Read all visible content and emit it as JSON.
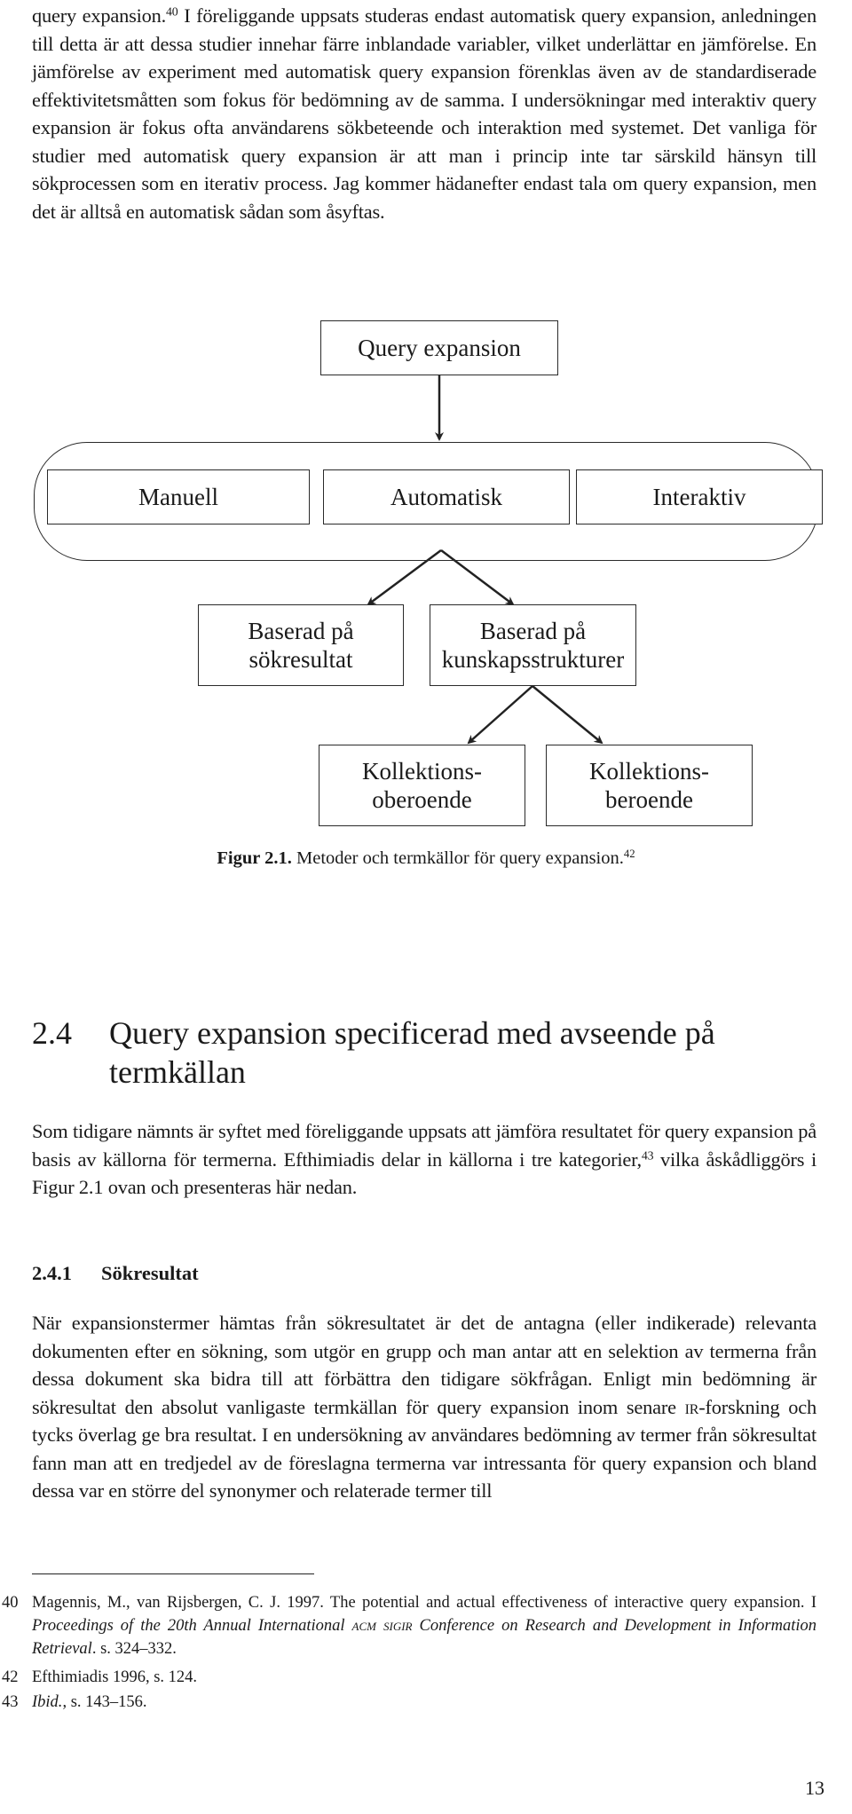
{
  "intro_paragraph": {
    "line_1a": "query expansion.",
    "sup_40": "40",
    "rest": " I föreliggande uppsats studeras endast automatisk query expansion, anledningen till detta är att dessa studier innehar färre inblandade variabler, vilket underlättar en jämförelse. En jämförelse av experiment med automatisk query expansion förenklas även av de standardiserade effektivitetsmåtten som fokus för bedömning av de samma. I undersökningar med interaktiv query expansion är fokus ofta användarens sökbeteende och interaktion med systemet. Det vanliga för studier med automatisk query expansion är att man i princip inte tar särskild hänsyn till sökprocessen som en iterativ process. Jag kommer hädanefter endast tala om query expansion, men det är alltså en automatisk sådan som åsyftas."
  },
  "figure": {
    "root": "Query expansion",
    "methods": [
      "Manuell",
      "Automatisk",
      "Interaktiv"
    ],
    "sources": [
      {
        "line1": "Baserad på",
        "line2": "sökresultat"
      },
      {
        "line1": "Baserad på",
        "line2": "kunskapsstrukturer"
      }
    ],
    "structures": [
      {
        "line1": "Kollektions-",
        "line2": "oberoende"
      },
      {
        "line1": "Kollektions-",
        "line2": "beroende"
      }
    ],
    "caption_label": "Figur 2.1.",
    "caption_text": " Metoder och termkällor för query expansion.",
    "caption_sup": "42"
  },
  "section": {
    "number": "2.4",
    "title": "Query expansion specificerad med avseende på termkällan",
    "paragraph_a": "Som tidigare nämnts är syftet med föreliggande uppsats att jämföra resultatet för query expansion på basis av källorna för termerna. Efthimiadis delar in källorna i tre kategorier,",
    "sup_43": "43",
    "paragraph_b": " vilka åskådliggörs i Figur 2.1 ovan och presenteras här nedan."
  },
  "subsection": {
    "number": "2.4.1",
    "title": "Sökresultat",
    "para_a": "När expansionstermer hämtas från sökresultatet är det de antagna (eller indikerade) relevanta dokumenten efter en sökning, som utgör en grupp och man antar att en selektion av termerna från dessa dokument ska bidra till att förbättra den tidigare sökfrågan. Enligt min bedömning är sökresultat den absolut vanligaste termkällan för query expansion inom senare ",
    "ir": "IR",
    "para_b": "-forskning och tycks överlag ge bra resultat. I en undersökning av användares bedömning av termer från sökresultat fann man att en tredjedel av de föreslagna termerna var intressanta för query expansion och bland dessa var en större del synonymer och relaterade termer till"
  },
  "footnotes": [
    {
      "number": "40",
      "pre": "Magennis, M., van Rijsbergen, C. J. 1997. The potential and actual effectiveness of interactive query expansion. I ",
      "italic_a": "Proceedings of the 20th Annual International ",
      "sc": "ACM SIGIR",
      "italic_b": " Conference on Research and Development in Information Retrieval",
      "post": ". s. 324–332."
    },
    {
      "number": "42",
      "text": "Efthimiadis 1996, s. 124."
    },
    {
      "number": "43",
      "italic": "Ibid.",
      "text": ", s. 143–156."
    }
  ],
  "page_number": "13"
}
